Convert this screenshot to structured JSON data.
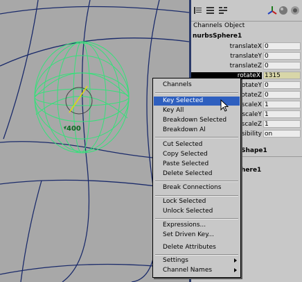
{
  "viewport": {
    "locator_label": "400"
  },
  "channel_box": {
    "menus": [
      "Channels",
      "Object"
    ],
    "node_name": "nurbsSphere1",
    "attributes": [
      {
        "label": "translateX",
        "value": "0"
      },
      {
        "label": "translateY",
        "value": "0"
      },
      {
        "label": "translateZ",
        "value": "0"
      },
      {
        "label": "rotateX",
        "value": "1315"
      },
      {
        "label": "rotateY",
        "value": "0"
      },
      {
        "label": "rotateZ",
        "value": "0"
      },
      {
        "label": "scaleX",
        "value": "1"
      },
      {
        "label": "scaleY",
        "value": "1"
      },
      {
        "label": "scaleZ",
        "value": "1"
      },
      {
        "label": "Visibility",
        "value": "on"
      }
    ],
    "shapes_label": "Shape1",
    "inputs_label": "here1"
  },
  "context_menu": {
    "title": "Channels",
    "items": [
      "Key Selected",
      "Key All",
      "Breakdown Selected",
      "Breakdown Al",
      "Cut Selected",
      "Copy Selected",
      "Paste Selected",
      "Delete Selected",
      "Break Connections",
      "Lock Selected",
      "Unlock Selected",
      "Expressions...",
      "Set Driven Key...",
      "Delete Attributes",
      "Settings",
      "Channel Names"
    ]
  },
  "colors": {
    "selection": "#2e5fbf",
    "wireframe": "#36e07a",
    "viewport_bg": "#a8a8a8"
  }
}
